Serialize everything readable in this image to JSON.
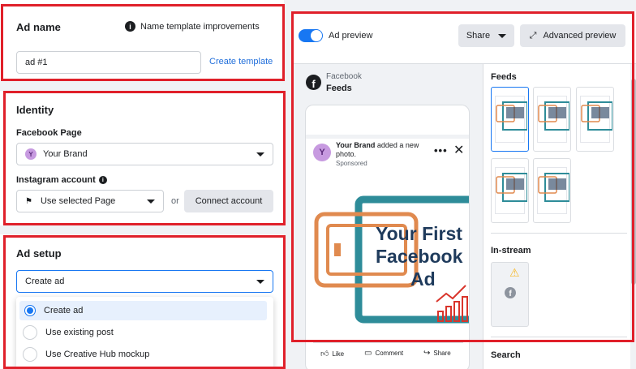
{
  "ad_name": {
    "title": "Ad name",
    "template_info": "Name template improvements",
    "value": "ad #1",
    "create_template": "Create template"
  },
  "identity": {
    "title": "Identity",
    "facebook_page_label": "Facebook Page",
    "facebook_page_value": "Your Brand",
    "facebook_page_avatar": "Y",
    "instagram_label": "Instagram account",
    "instagram_value": "Use selected Page",
    "or": "or",
    "connect": "Connect account"
  },
  "ad_setup": {
    "title": "Ad setup",
    "selected": "Create ad",
    "options": [
      "Create ad",
      "Use existing post",
      "Use Creative Hub mockup"
    ]
  },
  "preview": {
    "toggle_label": "Ad preview",
    "share": "Share",
    "advanced": "Advanced preview",
    "platform": "Facebook",
    "placement": "Feeds",
    "post_brand": "Your Brand",
    "post_action": "added a new photo.",
    "sponsored": "Sponsored",
    "creative_text_1": "Your First",
    "creative_text_2": "Facebook",
    "creative_text_3": "Ad",
    "like": "Like",
    "comment": "Comment",
    "share_action": "Share"
  },
  "placements": {
    "feeds": "Feeds",
    "instream": "In-stream",
    "search": "Search"
  },
  "colors": {
    "accent": "#1877f2",
    "red_highlight": "#e0202a",
    "creative_teal": "#2e8c99",
    "creative_orange": "#e08a4f",
    "creative_navy": "#1f3b5c"
  }
}
